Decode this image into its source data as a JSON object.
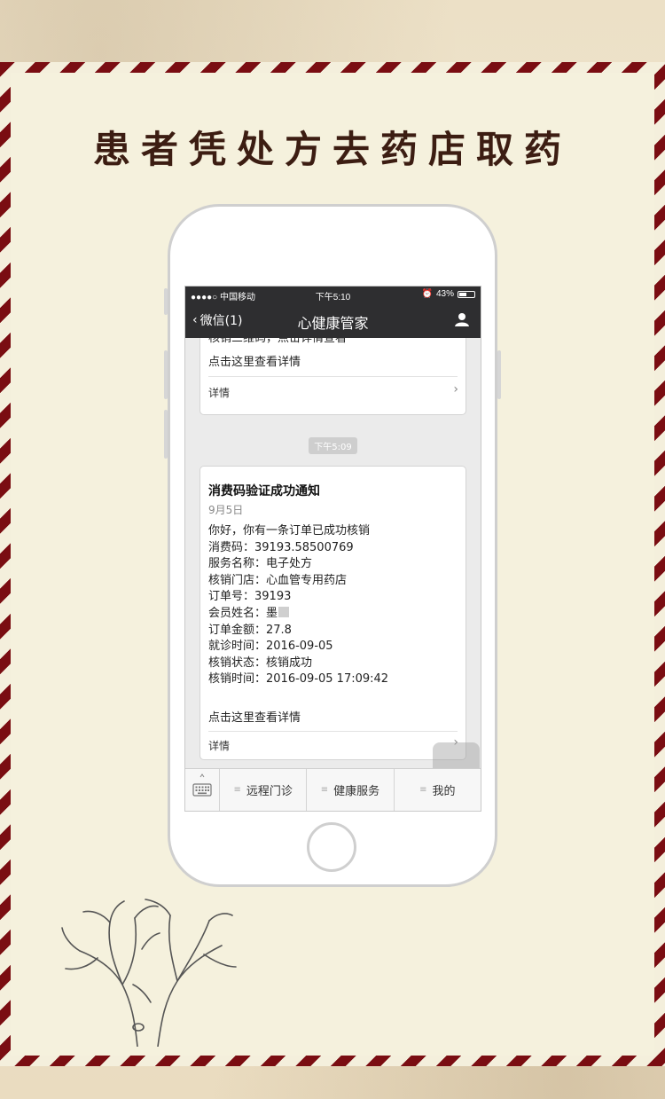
{
  "headline": "患者凭处方去药店取药",
  "status_bar": {
    "carrier": "●●●●○ 中国移动",
    "time": "下午5:10",
    "battery_pct": "43%"
  },
  "nav": {
    "back_label": "微信(1)",
    "title": "心健康管家",
    "icon": "user-icon"
  },
  "messages": {
    "first_card": {
      "peek_text": "核销三维码，点击详情查看",
      "link": "点击这里查看详情",
      "detail_label": "详情"
    },
    "timestamp": "下午5:09",
    "second_card": {
      "title": "消费码验证成功通知",
      "date": "9月5日",
      "greeting": "你好，你有一条订单已成功核销",
      "fields": [
        "消费码：39193.58500769",
        "服务名称：电子处方",
        "核销门店：心血管专用药店",
        "订单号：39193",
        "会员姓名：墨",
        "订单金额：27.8",
        "就诊时间：2016-09-05",
        "核销状态：核销成功",
        "核销时间：2016-09-05 17:09:42"
      ],
      "link": "点击这里查看详情",
      "detail_label": "详情"
    }
  },
  "menu": {
    "keyboard_icon": "keyboard-icon",
    "items": [
      "远程门诊",
      "健康服务",
      "我的"
    ]
  },
  "colors": {
    "stripe_red": "#7a0d12",
    "paper": "#f5f1dd",
    "title_brown": "#3c1d12",
    "wechat_bar": "#2e2e30"
  }
}
